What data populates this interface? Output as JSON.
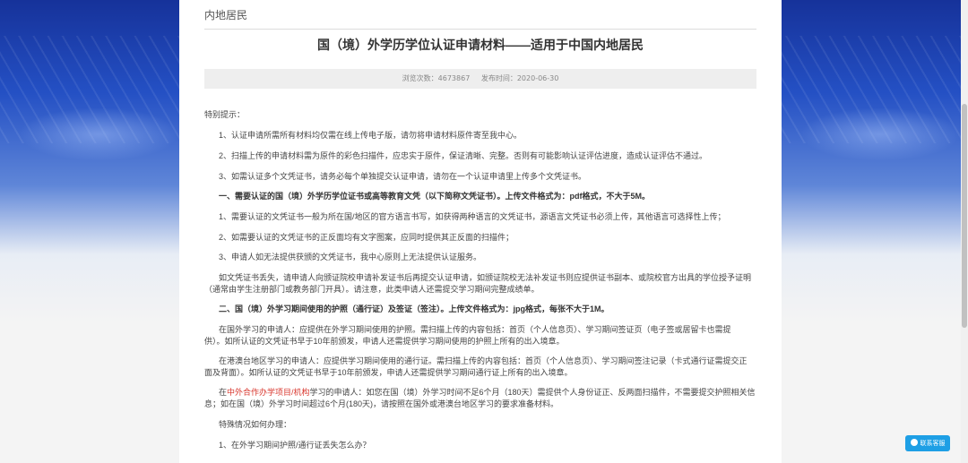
{
  "breadcrumb": "内地居民",
  "title": "国（境）外学历学位认证申请材料——适用于中国内地居民",
  "meta": {
    "views_label": "浏览次数：",
    "views": "4673867",
    "date_label": "发布时间：",
    "date": "2020-06-30"
  },
  "content": {
    "tip": "特别提示：",
    "p1": "1、认证申请所需所有材料均仅需在线上传电子版，请勿将申请材料原件寄至我中心。",
    "p2": "2、扫描上传的申请材料需为原件的彩色扫描件，应忠实于原件，保证清晰、完整。否则有可能影响认证评估进度，造成认证评估不通过。",
    "p3": "3、如需认证多个文凭证书，请务必每个单独提交认证申请，请勿在一个认证申请里上传多个文凭证书。",
    "h1": "一、需要认证的国（境）外学历学位证书或高等教育文凭（以下简称文凭证书）。上传文件格式为：pdf格式，不大于5M。",
    "a1": "1、需要认证的文凭证书一般为所在国/地区的官方语言书写，如获得两种语言的文凭证书，源语言文凭证书必须上传，其他语言可选择性上传；",
    "a2": "2、如需要认证的文凭证书的正反面均有文字图案，应同时提供其正反面的扫描件；",
    "a3": "3、申请人如无法提供获颁的文凭证书，我中心原则上无法提供认证服务。",
    "lost_line1": "如文凭证书丢失，请申请人向颁证院校申请补发证书后再提交认证申请，如颁证院校无法补发证书则应提供证书副本、或院校官方出具的学位授予证明",
    "lost_line2": "（通常由学生注册部门或教务部门开具）。请注意，此类申请人还需提交学习期间完整成绩单。",
    "h2": "二、国（境）外学习期间使用的护照（通行证）及签证（签注）。上传文件格式为：jpg格式，每张不大于1M。",
    "b1_line1": "在国外学习的申请人：应提供在外学习期间使用的护照。需扫描上传的内容包括：首页（个人信息页）、学习期间签证页（电子签或居留卡也需提",
    "b1_line2": "供）。如所认证的文凭证书早于10年前颁发，申请人还需提供学习期间使用的护照上所有的出入境章。",
    "b2_line1": "在港澳台地区学习的申请人：应提供学习期间使用的通行证。需扫描上传的内容包括：首页（个人信息页）、学习期间签注记录（卡式通行证需提交正",
    "b2_line2": "面及背面）。如所认证的文凭证书早于10年前颁发，申请人还需提供学习期间通行证上所有的出入境章。",
    "b3_prefix": "在",
    "b3_red": "中外合作办学项目/机构",
    "b3_rest": "学习的申请人：如您在国（境）外学习时间不足6个月（180天）需提供个人身份证正、反两面扫描件，不需要提交护照相关信",
    "b3_line2": "息；如在国（境）外学习时间超过6个月(180天)，请按照在国外或港澳台地区学习的要求准备材料。",
    "special": "特殊情况如何办理：",
    "q1": "1、在外学习期间护照/通行证丢失怎么办？"
  },
  "float_button": "联系客服"
}
